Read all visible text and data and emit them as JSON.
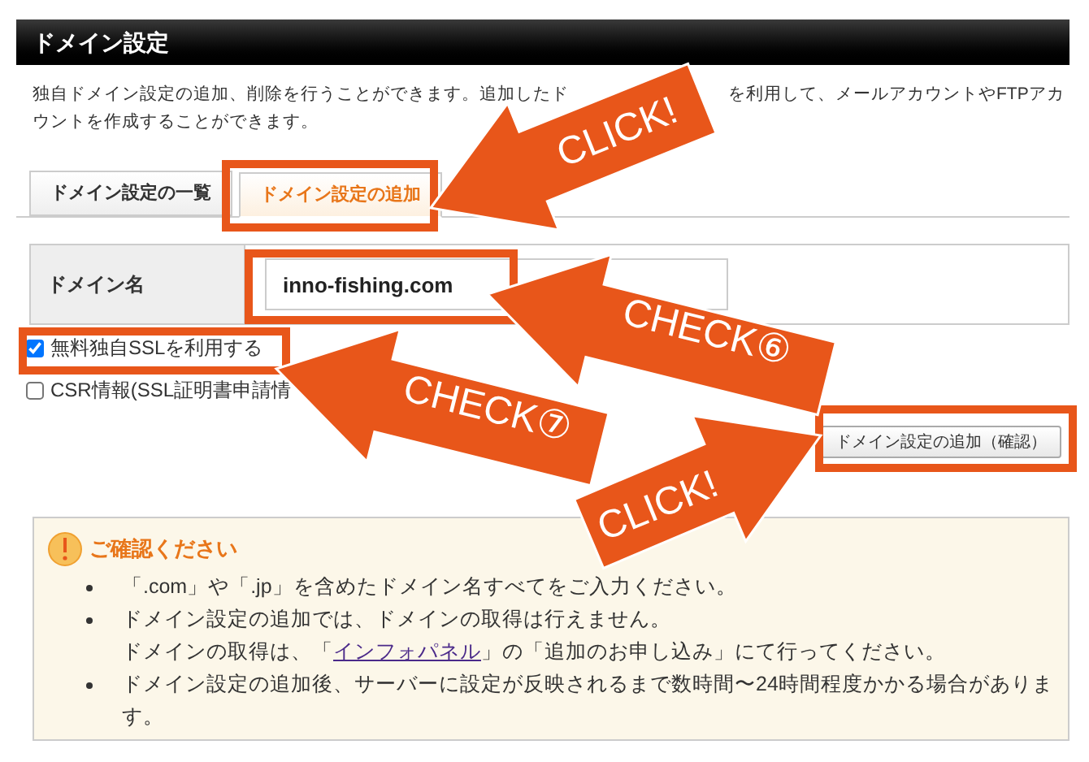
{
  "header": {
    "title": "ドメイン設定"
  },
  "description": {
    "line_1_start": "独自ドメイン設定の追加、削除を行うことができます。追加したド",
    "line_1_end": "を利用して、メールアカウントやFTPアカ",
    "line_2": "ウントを作成することができます。"
  },
  "tabs": [
    {
      "label": "ドメイン設定の一覧",
      "selected": false
    },
    {
      "label": "ドメイン設定の追加",
      "selected": true
    }
  ],
  "form": {
    "label": "ドメイン名",
    "value": "inno-fishing.com"
  },
  "options": [
    {
      "label": "無料独自SSLを利用する",
      "checked": true
    },
    {
      "label": "CSR情報(SSL証明書申請情",
      "checked": false
    }
  ],
  "submit_button": "ドメイン設定の追加（確認）",
  "notice": {
    "title": "ご確認ください",
    "items": [
      {
        "text": "「.com」や「.jp」を含めたドメイン名すべてをご入力ください。"
      },
      {
        "text": "ドメイン設定の追加では、ドメインの取得は行えません。",
        "note": {
          "before": "ドメインの取得は、「",
          "link": "インフォパネル",
          "after": "」の「追加のお申し込み」にて行ってください。"
        }
      },
      {
        "text": "ドメイン設定の追加後、サーバーに設定が反映されるまで数時間〜24時間程度かかる場合があります。"
      }
    ]
  },
  "annotations": [
    {
      "kind": "arrow",
      "label": "CLICK!"
    },
    {
      "kind": "arrow",
      "label": "CHECK⑥"
    },
    {
      "kind": "arrow",
      "label": "CHECK⑦"
    },
    {
      "kind": "arrow",
      "label": "CLICK!"
    }
  ]
}
